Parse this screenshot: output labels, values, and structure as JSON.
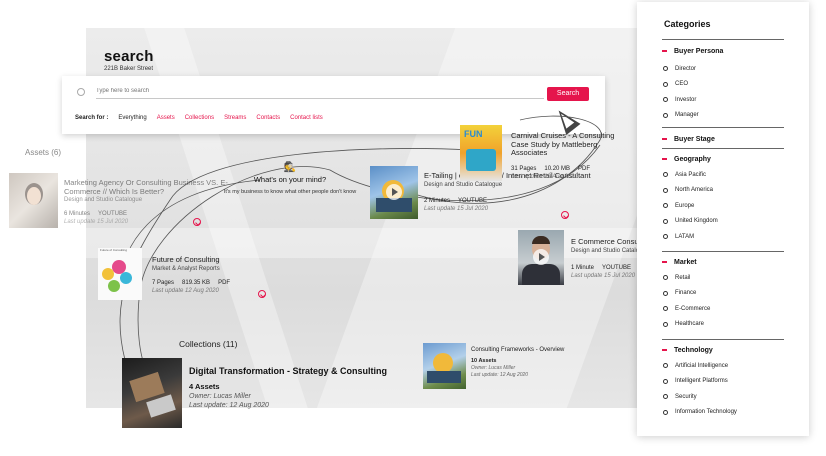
{
  "header": {
    "title": "search",
    "address": "221B Baker Street"
  },
  "search": {
    "placeholder": "Type here to search",
    "button_label": "Search",
    "search_for_label": "Search for :",
    "options": [
      "Everything",
      "Assets",
      "Collections",
      "Streams",
      "Contacts",
      "Contact lists"
    ],
    "active_option": "Everything"
  },
  "assets_label": "Assets (6)",
  "collections_label": "Collections (11)",
  "mind": {
    "question": "What's on your mind?",
    "subtitle": "It's my business to know what other people don't know"
  },
  "assets": [
    {
      "title": "Marketing Agency Or Consulting Business VS. E-Commerce // Which Is Better?",
      "subtitle": "Design and Studio Catalogue",
      "meta1": "6 Minutes",
      "meta2": "YOUTUBE",
      "updated": "Last update 15 Jul 2020"
    },
    {
      "title": "Future of Consulting",
      "subtitle": "Market & Analyst Reports",
      "meta1": "7 Pages",
      "meta2": "819.35 KB",
      "meta3": "PDF",
      "updated": "Last update 12 Aug 2020",
      "thumb_caption": "Future of Consulting"
    },
    {
      "title": "E-Tailing | eCommerce / Internet Retail Consultant",
      "subtitle": "Design and Studio Catalogue",
      "meta1": "2 Minutes",
      "meta2": "YOUTUBE",
      "updated": "Last update 15 Jul 2020"
    },
    {
      "title": "Carnival Cruises - A Consulting Case Study by Mattleberg Associates",
      "meta1": "31 Pages",
      "meta2": "10.20 MB",
      "meta3": "PDF",
      "updated": "Last update 12 Aug 2020"
    },
    {
      "title": "E Commerce Consulting",
      "subtitle": "Design and Studio Catalogue",
      "meta1": "1 Minute",
      "meta2": "YOUTUBE",
      "updated": "Last update 15 Jul 2020"
    }
  ],
  "collections": [
    {
      "title": "Digital Transformation - Strategy & Consulting",
      "count": "4 Assets",
      "owner": "Owner: Lucas Miller",
      "updated": "Last update: 12 Aug 2020"
    },
    {
      "title": "Consulting Frameworks - Overview",
      "count": "10 Assets",
      "owner": "Owner: Lucas Miller",
      "updated": "Last update: 12 Aug 2020"
    }
  ],
  "categories": {
    "title": "Categories",
    "groups": [
      {
        "name": "Buyer Persona",
        "items": [
          "Director",
          "CEO",
          "Investor",
          "Manager"
        ]
      },
      {
        "name": "Buyer Stage",
        "items": []
      },
      {
        "name": "Geography",
        "items": [
          "Asia Pacific",
          "North America",
          "Europe",
          "United Kingdom",
          "LATAM"
        ]
      },
      {
        "name": "Market",
        "items": [
          "Retail",
          "Finance",
          "E-Commerce",
          "Healthcare"
        ]
      },
      {
        "name": "Technology",
        "items": [
          "Artificial Intelligence",
          "Intelligent Platforms",
          "Security",
          "Information Technology"
        ]
      }
    ]
  },
  "colors": {
    "accent": "#e5154c",
    "panel_bg": "#ffffff"
  }
}
